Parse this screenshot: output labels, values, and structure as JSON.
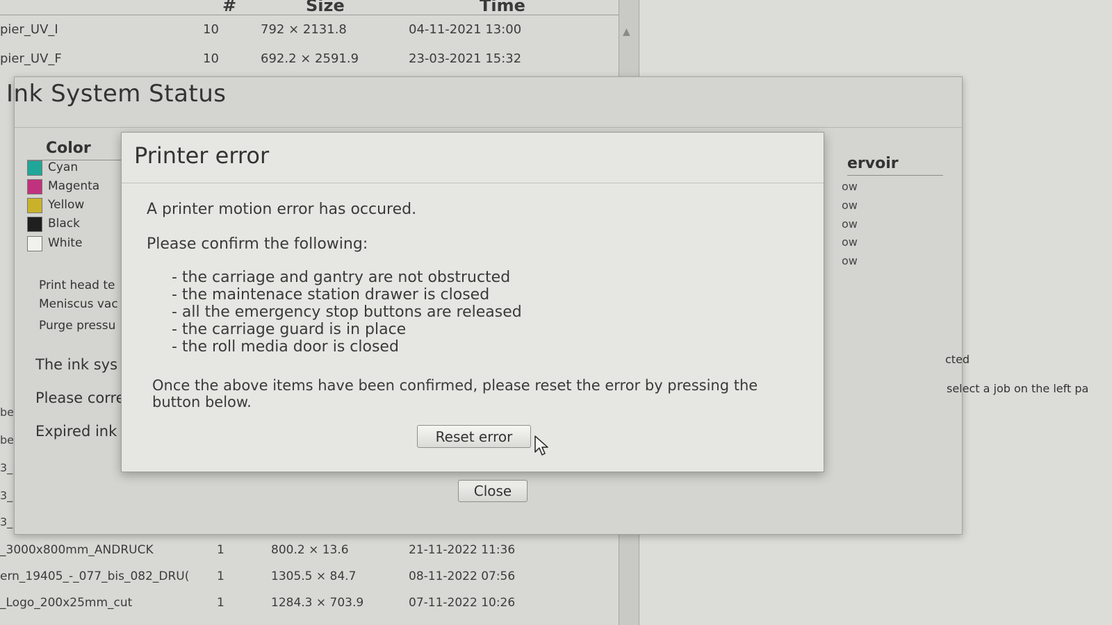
{
  "job_list": {
    "columns": {
      "count": "#",
      "size": "Size",
      "time": "Time"
    },
    "top_rows": [
      {
        "name": "pier_UV_I",
        "count": "10",
        "size": "792 × 2131.8",
        "time": "04-11-2021 13:00"
      },
      {
        "name": "pier_UV_F",
        "count": "10",
        "size": "692.2 × 2591.9",
        "time": "23-03-2021 15:32"
      }
    ],
    "bottom_rows": [
      {
        "name": "_3000x800mm_ANDRUCK",
        "count": "1",
        "size": "800.2 × 13.6",
        "time": "21-11-2022 11:36"
      },
      {
        "name": "ern_19405_-_077_bis_082_DRU(",
        "count": "1",
        "size": "1305.5 × 84.7",
        "time": "08-11-2022 07:56"
      },
      {
        "name": "_Logo_200x25mm_cut",
        "count": "1",
        "size": "1284.3 × 703.9",
        "time": "07-11-2022 10:26"
      }
    ],
    "left_fragments": [
      "be",
      "be",
      "3_",
      "3_",
      "3_"
    ]
  },
  "ink_window": {
    "title": "Ink System Status",
    "color_header": "Color",
    "colors": [
      {
        "label": "Cyan",
        "swatch": "#1fa79a"
      },
      {
        "label": "Magenta",
        "swatch": "#c0327e"
      },
      {
        "label": "Yellow",
        "swatch": "#c9b22a"
      },
      {
        "label": "Black",
        "swatch": "#1f1f1f"
      },
      {
        "label": "White",
        "swatch": "#f1f1ee"
      }
    ],
    "params": [
      "Print head te",
      "Meniscus vac",
      "Purge pressu"
    ],
    "messages": [
      "The ink sys",
      "Please corre",
      "Expired ink"
    ],
    "reservoir_header": "ervoir",
    "reservoir_values": [
      "ow",
      "ow",
      "ow",
      "ow",
      "ow"
    ],
    "right_text_1": "cted",
    "right_text_2": "select a job on the left pa",
    "close_label": "Close"
  },
  "error_dialog": {
    "title": "Printer error",
    "intro": "A printer motion error has occured.",
    "confirm_heading": "Please confirm the following:",
    "items": [
      "- the carriage and gantry are not obstructed",
      "- the maintenace station drawer is closed",
      "- all the emergency stop buttons are released",
      "- the carriage guard is in place",
      "- the roll media door is closed"
    ],
    "instruction": "Once the above items have been confirmed, please reset the error by pressing the button below.",
    "reset_label": "Reset error"
  }
}
